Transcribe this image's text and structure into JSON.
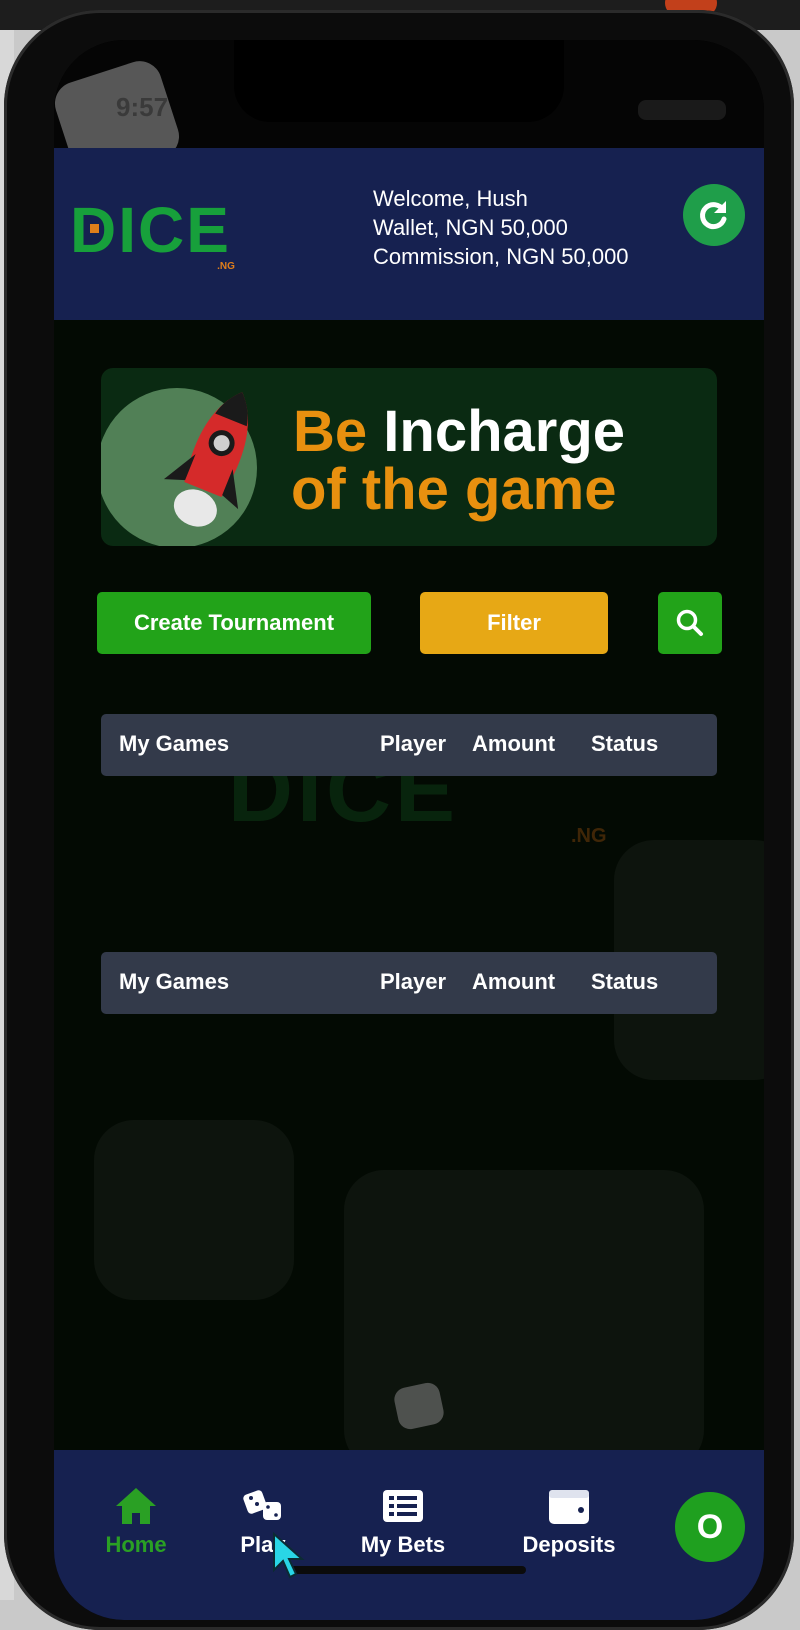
{
  "status_bar": {
    "time": "9:57"
  },
  "header": {
    "logo_text": "DICE",
    "logo_suffix": ".NG",
    "welcome": "Welcome, Hush",
    "wallet": "Wallet, NGN 50,000",
    "commission": "Commission, NGN 50,000"
  },
  "banner": {
    "word1": "Be",
    "word2": "Incharge",
    "line2": "of the game"
  },
  "actions": {
    "create_label": "Create Tournament",
    "filter_label": "Filter"
  },
  "tables": [
    {
      "columns": [
        "My Games",
        "Player",
        "Amount",
        "Status"
      ]
    },
    {
      "columns": [
        "My Games",
        "Player",
        "Amount",
        "Status"
      ]
    }
  ],
  "watermark": {
    "text": "DICE",
    "suffix": ".NG"
  },
  "bottom_nav": {
    "items": [
      {
        "label": "Home",
        "icon": "home-icon",
        "active": true
      },
      {
        "label": "Play",
        "icon": "dice-icon",
        "active": false
      },
      {
        "label": "My Bets",
        "icon": "list-icon",
        "active": false
      },
      {
        "label": "Deposits",
        "icon": "wallet-icon",
        "active": false
      }
    ],
    "avatar_initial": "O"
  },
  "colors": {
    "header_bg": "#162150",
    "accent_green": "#22a319",
    "filter_yellow": "#e7a815",
    "banner_orange": "#e8900f",
    "table_head_bg": "#333a4a"
  }
}
